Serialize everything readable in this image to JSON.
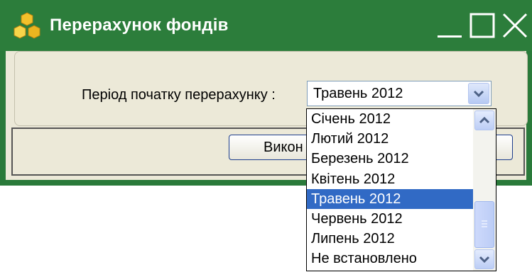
{
  "window": {
    "title": "Перерахунок фондів"
  },
  "form": {
    "period_label": "Період початку перерахунку :",
    "execute_button": "Викон"
  },
  "combo": {
    "selected": "Травень 2012"
  },
  "dropdown": {
    "items": [
      "Січень 2012",
      "Лютий 2012",
      "Березень 2012",
      "Квітень 2012",
      "Травень 2012",
      "Червень 2012",
      "Липень 2012",
      "Не встановлено"
    ],
    "selected_index": 4
  },
  "colors": {
    "titlebar": "#2c7d3b",
    "selection": "#316ac5",
    "client_bg": "#ece9d8"
  },
  "icons": {
    "app": "honeycomb-icon",
    "minimize": "minimize-icon",
    "maximize": "maximize-icon",
    "close": "close-icon"
  }
}
